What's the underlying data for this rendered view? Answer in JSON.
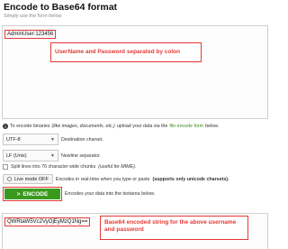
{
  "header": {
    "title": "Encode to Base64 format",
    "subtitle": "Simply use the form below"
  },
  "input": {
    "value": "AdminUser:123456",
    "callout": "UserName and Password separated by colon"
  },
  "info": {
    "prefix": "To encode binaries",
    "italic": "(like images, documents, etc.)",
    "mid": "upload your data via the",
    "link": "file encode form",
    "suffix": "below."
  },
  "options": {
    "charset_value": "UTF-8",
    "charset_label": "Destination charset.",
    "newline_value": "LF (Unix)",
    "newline_label": "Newline separator.",
    "split_label_a": "Split lines into 76 character wide chunks",
    "split_label_b": "(useful for MIME).",
    "live_label": "Live mode OFF",
    "live_desc_a": "Encodes in real-time when you type or paste",
    "live_desc_b": "(supports only unicode charsets)."
  },
  "encode": {
    "button_label": "ENCODE",
    "button_icon": "chevron-right-icon",
    "note": "Encodes your data into the textarea below."
  },
  "output": {
    "value": "QWRtaW5Vc2VyOjEyMzQ1Ng==",
    "callout": "Base64 encoded string for the above username and password"
  },
  "colors": {
    "accent_red": "#e53935",
    "encode_green": "#3b9a1e",
    "link_green": "#3a8a1f"
  }
}
